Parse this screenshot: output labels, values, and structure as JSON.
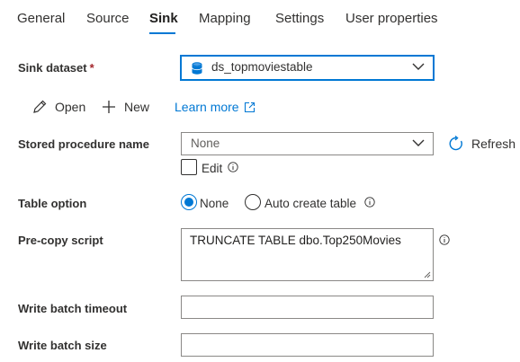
{
  "tabs": [
    {
      "label": "General",
      "active": false
    },
    {
      "label": "Source",
      "active": false
    },
    {
      "label": "Sink",
      "active": true
    },
    {
      "label": "Mapping",
      "active": false
    },
    {
      "label": "Settings",
      "active": false
    },
    {
      "label": "User properties",
      "active": false
    }
  ],
  "sink_dataset": {
    "label": "Sink dataset",
    "required_marker": "*",
    "value": "ds_topmoviestable",
    "icon": "database-icon"
  },
  "actions": {
    "open_label": "Open",
    "new_label": "New",
    "learn_more_label": "Learn more"
  },
  "stored_procedure": {
    "label": "Stored procedure name",
    "value": "None",
    "refresh_label": "Refresh",
    "edit_label": "Edit",
    "edit_checked": false
  },
  "table_option": {
    "label": "Table option",
    "options": [
      "None",
      "Auto create table"
    ],
    "selected": "None"
  },
  "pre_copy_script": {
    "label": "Pre-copy script",
    "value": "TRUNCATE TABLE dbo.Top250Movies"
  },
  "write_batch_timeout": {
    "label": "Write batch timeout",
    "value": ""
  },
  "write_batch_size": {
    "label": "Write batch size",
    "value": ""
  },
  "colors": {
    "accent": "#0078d4",
    "text": "#323130",
    "border": "#8a8886",
    "required": "#a4262c"
  }
}
